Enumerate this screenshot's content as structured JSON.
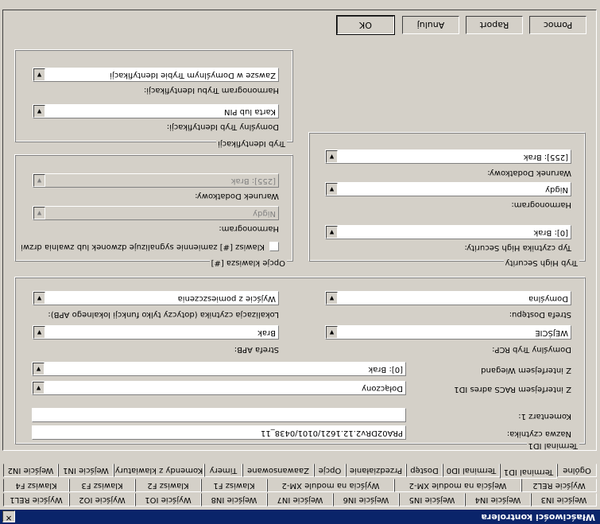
{
  "window": {
    "title": "Właściwości kontrolera",
    "close_glyph": "✕"
  },
  "tabs": {
    "row1": [
      "Wejście IN3",
      "Wejście IN4",
      "Wejście IN5",
      "Wejście IN6",
      "Wejście IN7",
      "Wejście IN8",
      "Wyjście IO1",
      "Wyjście IO2",
      "Wyjście REL1"
    ],
    "row2": [
      "Wyjście REL2",
      "Wejścia na module XM-2",
      "Wyjścia na module XM-2",
      "Klawisz F1",
      "Klawisz F2",
      "Klawisz F3",
      "Klawisz F4"
    ],
    "row3": [
      "Ogólne",
      "Terminal ID1",
      "Terminal ID0",
      "Dostęp",
      "Przedziałanie",
      "Opcje",
      "Zaawansowane",
      "Timery",
      "Komendy z klawiatury",
      "Wejście IN1",
      "Wejście IN2"
    ],
    "active": "Terminal ID1"
  },
  "terminal": {
    "group_label": "Terminal ID1",
    "reader_name_label": "Nazwa czytnika:",
    "reader_name_value": "PRA02DRv2.12.1621/0101/0438_11",
    "comment_label": "Komentarz 1:",
    "comment_value": "",
    "racs_label": "Z interfejsem RACS adres ID1",
    "racs_value": "Dołączony",
    "wiegand_label": "Z interfejsem Wiegand",
    "wiegand_value": "[0]: Brak",
    "rcp_label": "Domyślny Tryb RCP:",
    "rcp_value": "WEJŚCIE",
    "apb_label": "Strefa APB:",
    "apb_value": "Brak",
    "zone_label": "Strefa Dostępu:",
    "zone_value": "Domyślna",
    "location_label": "Lokalizacja czytnika (dotyczy tylko funkcji lokalnego APB):",
    "location_value": "Wyjście z pomieszczenia"
  },
  "high_security": {
    "group_label": "Tryb High Security",
    "type_label": "Typ czytnika High Security:",
    "type_value": "[0]: Brak",
    "schedule_label": "Harmonogram:",
    "schedule_value": "Nigdy",
    "condition_label": "Warunek Dodatkowy:",
    "condition_value": "[255]: Brak"
  },
  "key_options": {
    "group_label": "Opcje klawisza [#]",
    "checkbox_label": "Klawisz [#] zamiennie sygnalizuje dzwonek lub zwalnia drzwi",
    "schedule_label": "Harmonogram:",
    "schedule_value": "Nigdy",
    "condition_label": "Warunek Dodatkowy:",
    "condition_value": "[255]: Brak"
  },
  "identification": {
    "group_label": "Tryb Identyfikacji",
    "default_label": "Domyślny Tryb Identyfikacji:",
    "default_value": "Karta lub PIN",
    "schedule_label": "Harmonogram Trybu Identyfikacji:",
    "schedule_value": "Zawsze w Domyślnym Trybie Identyfikacji"
  },
  "buttons": {
    "ok": "OK",
    "cancel": "Anuluj",
    "report": "Raport",
    "help": "Pomoc"
  },
  "icons": {
    "combo_arrow": "▼"
  }
}
